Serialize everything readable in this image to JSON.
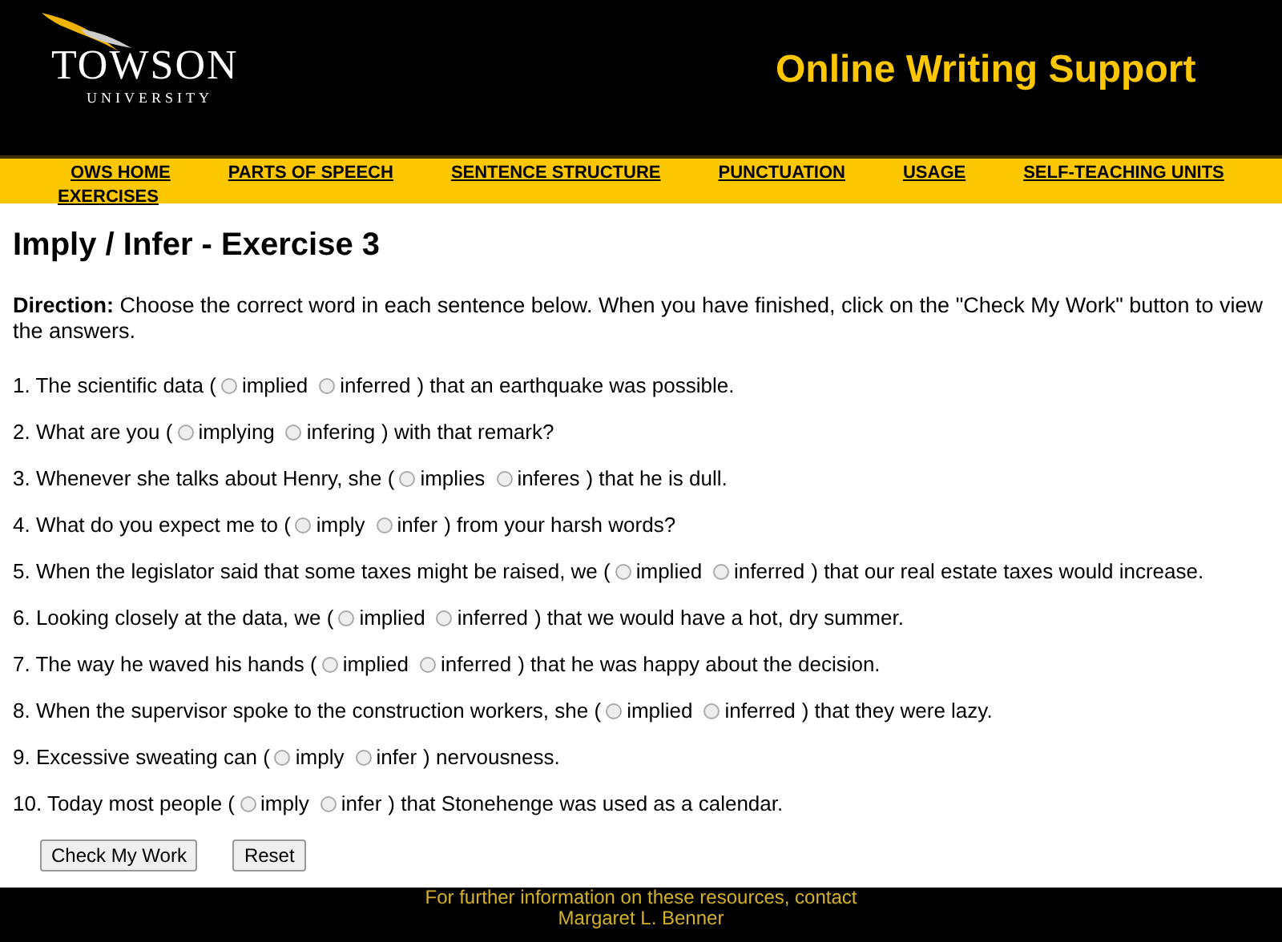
{
  "header": {
    "logo_name": "TOWSON",
    "logo_sub": "UNIVERSITY",
    "site_title": "Online Writing Support"
  },
  "nav": [
    {
      "label": "OWS HOME"
    },
    {
      "label": "PARTS OF SPEECH"
    },
    {
      "label": "SENTENCE STRUCTURE"
    },
    {
      "label": "PUNCTUATION"
    },
    {
      "label": "USAGE"
    },
    {
      "label": "SELF-TEACHING UNITS"
    },
    {
      "label": "EXERCISES"
    }
  ],
  "title": "Imply / Infer - Exercise 3",
  "direction": "**Direction:** Choose the correct word in each sentence below. When you have finished, click on the \"Check My Work\" button to view the answers.",
  "questions": [
    {
      "prefix": "1. The scientific data (",
      "options": [
        {
          "label": "implied",
          "selected": false
        },
        {
          "label": "inferred",
          "selected": false
        }
      ],
      "suffix": ") that an earthquake was possible."
    },
    {
      "prefix": "2. What are you (",
      "options": [
        {
          "label": "implying",
          "selected": false
        },
        {
          "label": "infering",
          "selected": false
        }
      ],
      "suffix": ") with that remark?"
    },
    {
      "prefix": "3. Whenever she talks about Henry, she (",
      "options": [
        {
          "label": "implies",
          "selected": false
        },
        {
          "label": "inferes",
          "selected": false
        }
      ],
      "suffix": ") that he is dull."
    },
    {
      "prefix": "4. What do you expect me to (",
      "options": [
        {
          "label": "imply",
          "selected": false
        },
        {
          "label": "infer",
          "selected": false
        }
      ],
      "suffix": ") from your harsh words?"
    },
    {
      "prefix": "5. When the legislator said that some taxes might be raised, we (",
      "options": [
        {
          "label": "implied",
          "selected": false
        },
        {
          "label": "inferred",
          "selected": false
        }
      ],
      "suffix": ") that our real estate taxes would increase."
    },
    {
      "prefix": "6. Looking closely at the data, we (",
      "options": [
        {
          "label": "implied",
          "selected": false
        },
        {
          "label": "inferred",
          "selected": false
        }
      ],
      "suffix": ") that we would have a hot, dry summer."
    },
    {
      "prefix": "7. The way he waved his hands (",
      "options": [
        {
          "label": "implied",
          "selected": false
        },
        {
          "label": "inferred",
          "selected": false
        }
      ],
      "suffix": ") that he was happy about the decision."
    },
    {
      "prefix": "8. When the supervisor spoke to the construction workers, she (",
      "options": [
        {
          "label": "implied",
          "selected": false
        },
        {
          "label": "inferred",
          "selected": false
        }
      ],
      "suffix": ") that they were lazy."
    },
    {
      "prefix": "9. Excessive sweating can (",
      "options": [
        {
          "label": "imply",
          "selected": false
        },
        {
          "label": "infer",
          "selected": false
        }
      ],
      "suffix": ") nervousness."
    },
    {
      "prefix": "10. Today most people (",
      "options": [
        {
          "label": "imply",
          "selected": false
        },
        {
          "label": "infer",
          "selected": false
        }
      ],
      "suffix": ") that Stonehenge was used as a calendar."
    }
  ],
  "buttons": [
    "Check My Work",
    "Reset"
  ],
  "footer": [
    "For further information on these resources, contact",
    "Margaret L. Benner"
  ]
}
